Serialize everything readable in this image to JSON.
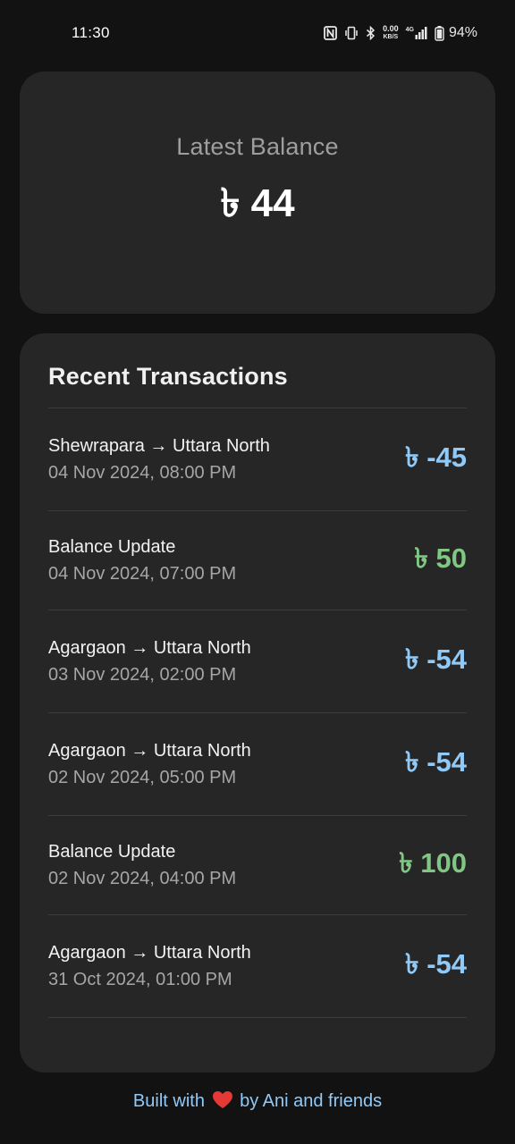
{
  "status_bar": {
    "time": "11:30",
    "net_speed_value": "0.00",
    "net_speed_unit": "KB/S",
    "network_type": "4G",
    "battery_percent": "94%",
    "icons": [
      "nfc-icon",
      "vibrate-icon",
      "bluetooth-icon",
      "net-speed-indicator",
      "signal-icon",
      "battery-icon"
    ]
  },
  "balance": {
    "label": "Latest Balance",
    "amount": "৳ 44"
  },
  "transactions": {
    "title": "Recent Transactions",
    "items": [
      {
        "description": "Shewrapara → Uttara North",
        "date": "04 Nov 2024, 08:00 PM",
        "amount": "৳ -45",
        "type": "debit"
      },
      {
        "description": "Balance Update",
        "date": "04 Nov 2024, 07:00 PM",
        "amount": "৳ 50",
        "type": "credit"
      },
      {
        "description": "Agargaon → Uttara North",
        "date": "03 Nov 2024, 02:00 PM",
        "amount": "৳ -54",
        "type": "debit"
      },
      {
        "description": "Agargaon → Uttara North",
        "date": "02 Nov 2024, 05:00 PM",
        "amount": "৳ -54",
        "type": "debit"
      },
      {
        "description": "Balance Update",
        "date": "02 Nov 2024, 04:00 PM",
        "amount": "৳ 100",
        "type": "credit"
      },
      {
        "description": "Agargaon → Uttara North",
        "date": "31 Oct 2024, 01:00 PM",
        "amount": "৳ -54",
        "type": "debit"
      }
    ]
  },
  "footer": {
    "prefix": "Built with",
    "suffix": "by Ani and friends",
    "icon": "heart-icon"
  },
  "colors": {
    "background": "#121212",
    "card": "#262626",
    "debit": "#90caf9",
    "credit": "#81c784",
    "footer_text": "#90caf9",
    "heart": "#e53935"
  }
}
